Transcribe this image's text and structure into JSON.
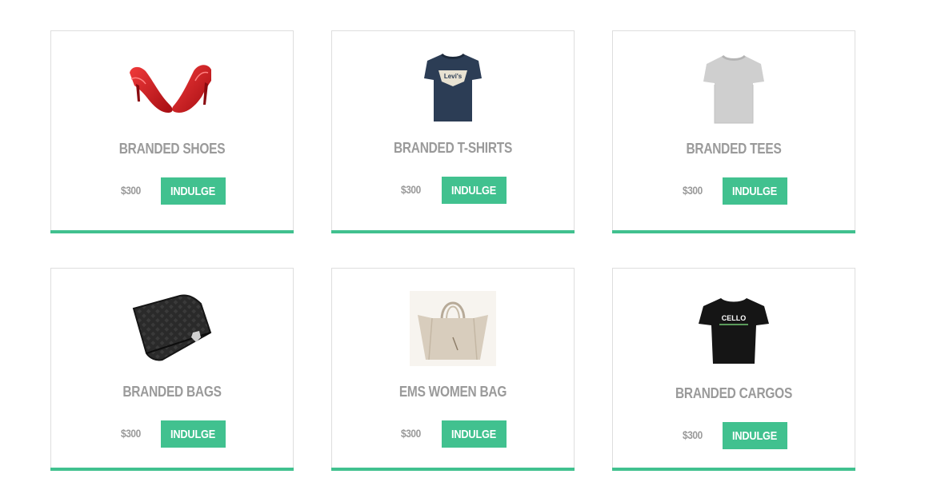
{
  "products": [
    {
      "name": "BRANDED SHOES",
      "price": "$300",
      "button": "INDULGE",
      "image": "red-high-heels"
    },
    {
      "name": "BRANDED T-SHIRTS",
      "price": "$300",
      "button": "INDULGE",
      "image": "navy-levis-tshirt"
    },
    {
      "name": "BRANDED TEES",
      "price": "$300",
      "button": "INDULGE",
      "image": "grey-tshirt"
    },
    {
      "name": "BRANDED BAGS",
      "price": "$300",
      "button": "INDULGE",
      "image": "black-wallet"
    },
    {
      "name": "EMS WOMEN BAG",
      "price": "$300",
      "button": "INDULGE",
      "image": "beige-handbag"
    },
    {
      "name": "BRANDED CARGOS",
      "price": "$300",
      "button": "INDULGE",
      "image": "black-cello-tshirt"
    }
  ],
  "levis_logo_text": "Levi's",
  "cello_logo_text": "CELLO",
  "colors": {
    "accent": "#41c18f",
    "title": "#9a9a9a",
    "border": "#dedede"
  }
}
